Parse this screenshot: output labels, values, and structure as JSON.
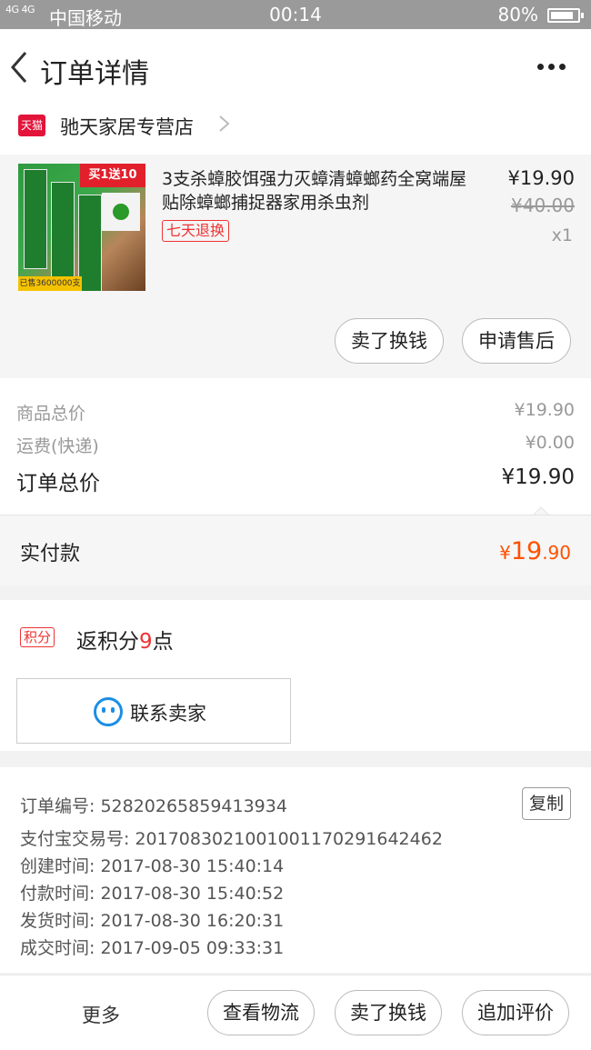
{
  "status_bar": {
    "signal": "4G 4G",
    "carrier": "中国移动",
    "time": "00:14",
    "battery": "80%",
    "battery_level": 0.8
  },
  "header": {
    "title": "订单详情"
  },
  "shop": {
    "badge": "天猫",
    "name": "驰天家居专营店"
  },
  "product": {
    "title": "3支杀蟑胶饵强力灭蟑清蟑螂药全窝端屋贴除蟑螂捕捉器家用杀虫剂",
    "tag": "七天退换",
    "price": "¥19.90",
    "original_price": "¥40.00",
    "quantity": "x1",
    "image_text": {
      "promo": "买1送10",
      "sold": "已售3600000支"
    },
    "actions": {
      "sell": "卖了换钱",
      "after_sale": "申请售后"
    }
  },
  "summary": {
    "goods_label": "商品总价",
    "goods_value": "¥19.90",
    "shipping_label": "运费(快递)",
    "shipping_value": "¥0.00",
    "total_label": "订单总价",
    "total_value": "¥19.90"
  },
  "paid": {
    "label": "实付款",
    "currency": "¥",
    "integer": "19",
    "decimal": ".90"
  },
  "points": {
    "badge": "积分",
    "prefix": "返积分",
    "count": "9",
    "suffix": "点"
  },
  "contact": {
    "label": "联系卖家"
  },
  "order_info": {
    "copy_label": "复制",
    "lines": [
      "订单编号: 52820265859413934",
      "支付宝交易号: 2017083021001001170291642462",
      "创建时间: 2017-08-30 15:40:14",
      "付款时间: 2017-08-30 15:40:52",
      "发货时间: 2017-08-30 16:20:31",
      "成交时间: 2017-09-05 09:33:31"
    ]
  },
  "footer": {
    "more": "更多",
    "logistics": "查看物流",
    "sell": "卖了换钱",
    "review": "追加评价"
  },
  "colors": {
    "accent": "#ff5000",
    "tmall_red": "#e3143a",
    "link_blue": "#1a8ee6"
  }
}
